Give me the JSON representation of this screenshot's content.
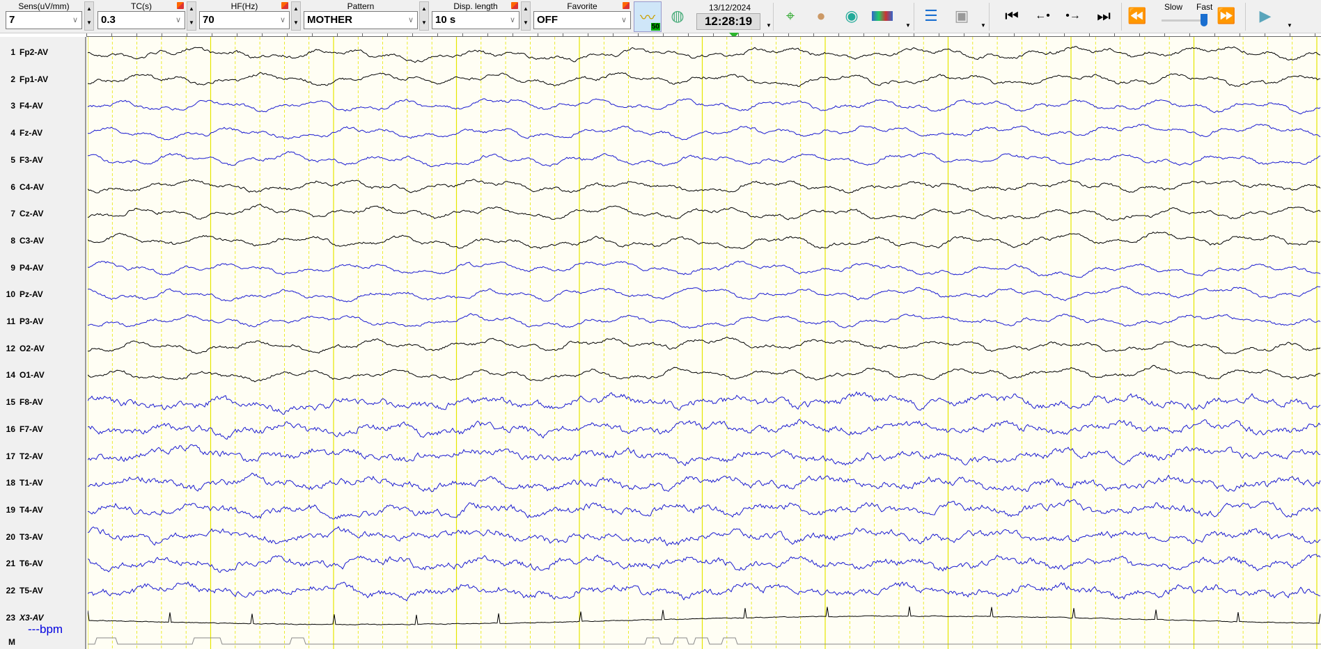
{
  "toolbar": {
    "sens": {
      "label": "Sens(uV/mm)",
      "value": "7"
    },
    "tc": {
      "label": "TC(s)",
      "value": "0.3"
    },
    "hf": {
      "label": "HF(Hz)",
      "value": "70"
    },
    "pattern": {
      "label": "Pattern",
      "value": "MOTHER"
    },
    "disp_length": {
      "label": "Disp. length",
      "value": "10 s"
    },
    "favorite": {
      "label": "Favorite",
      "value": "OFF"
    },
    "filter_badge": "50",
    "date": "13/12/2024",
    "time": "12:28:19",
    "speed": {
      "slow_label": "Slow",
      "fast_label": "Fast",
      "level": 1.0
    }
  },
  "channels": [
    {
      "num": "1",
      "name": "Fp2-AV",
      "color": "#000000"
    },
    {
      "num": "2",
      "name": "Fp1-AV",
      "color": "#000000"
    },
    {
      "num": "3",
      "name": "F4-AV",
      "color": "#1a1ad0"
    },
    {
      "num": "4",
      "name": "Fz-AV",
      "color": "#1a1ad0"
    },
    {
      "num": "5",
      "name": "F3-AV",
      "color": "#1a1ad0"
    },
    {
      "num": "6",
      "name": "C4-AV",
      "color": "#000000"
    },
    {
      "num": "7",
      "name": "Cz-AV",
      "color": "#000000"
    },
    {
      "num": "8",
      "name": "C3-AV",
      "color": "#000000"
    },
    {
      "num": "9",
      "name": "P4-AV",
      "color": "#1a1ad0"
    },
    {
      "num": "10",
      "name": "Pz-AV",
      "color": "#1a1ad0"
    },
    {
      "num": "11",
      "name": "P3-AV",
      "color": "#1a1ad0"
    },
    {
      "num": "12",
      "name": "O2-AV",
      "color": "#000000"
    },
    {
      "num": "14",
      "name": "O1-AV",
      "color": "#000000"
    },
    {
      "num": "15",
      "name": "F8-AV",
      "color": "#1a1ad0"
    },
    {
      "num": "16",
      "name": "F7-AV",
      "color": "#1a1ad0"
    },
    {
      "num": "17",
      "name": "T2-AV",
      "color": "#1a1ad0"
    },
    {
      "num": "18",
      "name": "T1-AV",
      "color": "#1a1ad0"
    },
    {
      "num": "19",
      "name": "T4-AV",
      "color": "#1a1ad0"
    },
    {
      "num": "20",
      "name": "T3-AV",
      "color": "#1a1ad0"
    },
    {
      "num": "21",
      "name": "T6-AV",
      "color": "#1a1ad0"
    },
    {
      "num": "22",
      "name": "T5-AV",
      "color": "#1a1ad0"
    },
    {
      "num": "23",
      "name": "X3-AV",
      "color": "#000000"
    }
  ],
  "marker_channel": "M",
  "heart_rate": "---bpm",
  "grid_color": "#e6e600"
}
